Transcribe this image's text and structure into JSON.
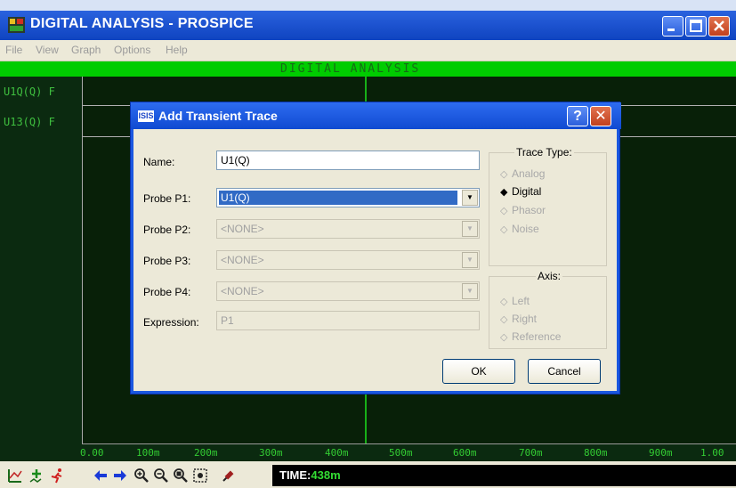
{
  "window": {
    "title": "DIGITAL ANALYSIS - PROSPICE",
    "min_label": "",
    "max_label": "",
    "close_label": ""
  },
  "menu": [
    "File",
    "View",
    "Graph",
    "Options",
    "Help"
  ],
  "graph": {
    "title": "DIGITAL ANALYSIS",
    "traces": [
      "U1Q(Q)  F",
      "U13(Q) F"
    ],
    "x_axis_labels": [
      "0.00",
      "100m",
      "200m",
      "300m",
      "400m",
      "500m",
      "600m",
      "700m",
      "800m",
      "900m",
      "1.00"
    ]
  },
  "toolbar": {
    "time_label": "TIME:",
    "time_value": "438m"
  },
  "dialog": {
    "title": "Add Transient Trace",
    "icon_text": "ISIS",
    "help_label": "?",
    "close_label": "✕",
    "name_label": "Name:",
    "name_value": "U1(Q)",
    "probes": [
      {
        "label": "Probe P1:",
        "value": "U1(Q)"
      },
      {
        "label": "Probe P2:",
        "value": "<NONE>"
      },
      {
        "label": "Probe P3:",
        "value": "<NONE>"
      },
      {
        "label": "Probe P4:",
        "value": "<NONE>"
      }
    ],
    "expression_label": "Expression:",
    "expression_value": "P1",
    "trace_type_title": "Trace Type:",
    "trace_types": [
      "Analog",
      "Digital",
      "Phasor",
      "Noise"
    ],
    "trace_type_selected": "Digital",
    "axis_title": "Axis:",
    "axis_options": [
      "Left",
      "Right",
      "Reference"
    ],
    "ok_label": "OK",
    "cancel_label": "Cancel"
  }
}
